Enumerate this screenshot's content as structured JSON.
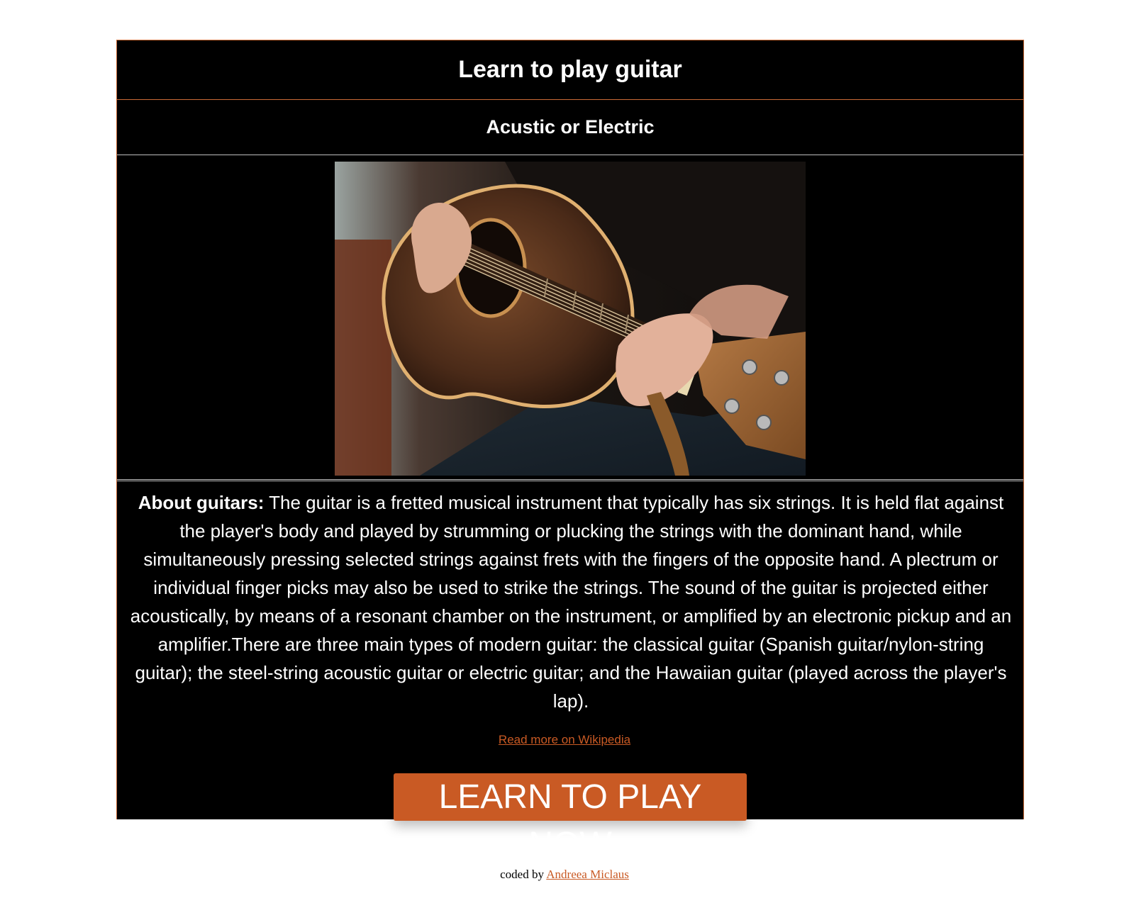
{
  "header": {
    "title": "Learn to play guitar",
    "subtitle": "Acustic or Electric"
  },
  "image": {
    "alt": "Person playing acoustic guitar"
  },
  "about": {
    "label": "About guitars:",
    "text": " The guitar is a fretted musical instrument that typically has six strings. It is held flat against the player's body and played by strumming or plucking the strings with the dominant hand, while simultaneously pressing selected strings against frets with the fingers of the opposite hand. A plectrum or individual finger picks may also be used to strike the strings. The sound of the guitar is projected either acoustically, by means of a resonant chamber on the instrument, or amplified by an electronic pickup and an amplifier.There are three main types of modern guitar: the classical guitar (Spanish guitar/nylon-string guitar); the steel-string acoustic guitar or electric guitar; and the Hawaiian guitar (played across the player's lap)."
  },
  "links": {
    "wikipedia": "Read more on Wikipedia"
  },
  "cta": {
    "label": "LEARN TO PLAY NOW"
  },
  "footer": {
    "prefix": "coded by ",
    "author": "Andreea Miclaus"
  },
  "colors": {
    "accent": "#c95a24",
    "background": "#000000",
    "text": "#ffffff"
  }
}
